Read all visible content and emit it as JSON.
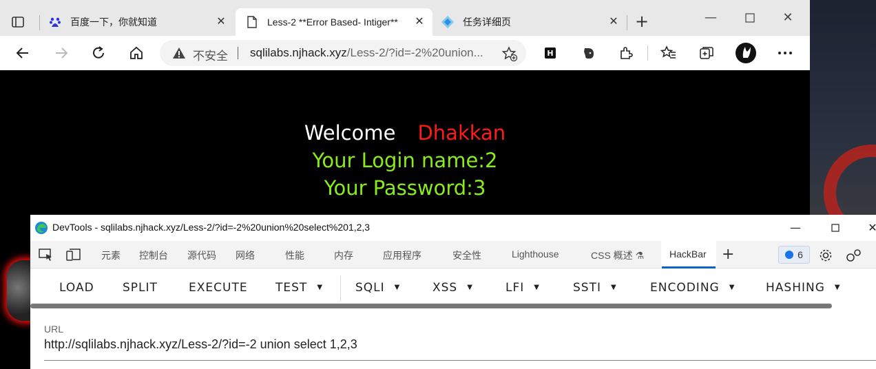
{
  "tabs": [
    {
      "label": "百度一下，你就知道",
      "icon": "baidu-paw-icon"
    },
    {
      "label": "Less-2 **Error Based- Intiger**",
      "icon": "page-icon"
    },
    {
      "label": "任务详细页",
      "icon": "diamond-icon"
    }
  ],
  "address": {
    "security_label": "不安全",
    "url_host": "sqlilabs.njhack.xyz",
    "url_path": "/Less-2/?id=-2%20union..."
  },
  "page": {
    "welcome": "Welcome",
    "name": "Dhakkan",
    "login_line": "Your Login name:2",
    "password_line": "Your Password:3"
  },
  "devtools": {
    "title": "DevTools - sqlilabs.njhack.xyz/Less-2/?id=-2%20union%20select%201,2,3",
    "tabs": [
      "元素",
      "控制台",
      "源代码",
      "网络",
      "性能",
      "内存",
      "应用程序",
      "安全性",
      "Lighthouse",
      "CSS 概述",
      "HackBar"
    ],
    "issues_count": "6"
  },
  "hackbar": {
    "buttons": [
      "LOAD",
      "SPLIT",
      "EXECUTE",
      "TEST",
      "SQLI",
      "XSS",
      "LFI",
      "SSTI",
      "ENCODING",
      "HASHING"
    ],
    "url_label": "URL",
    "url_value": "http://sqlilabs.njhack.xyz/Less-2/?id=-2 union select 1,2,3"
  },
  "colors": {
    "welcome": "#ffffff",
    "name": "#ff1a1a",
    "credentials": "#8aeb1a",
    "devtools_active": "#0e63c8"
  }
}
